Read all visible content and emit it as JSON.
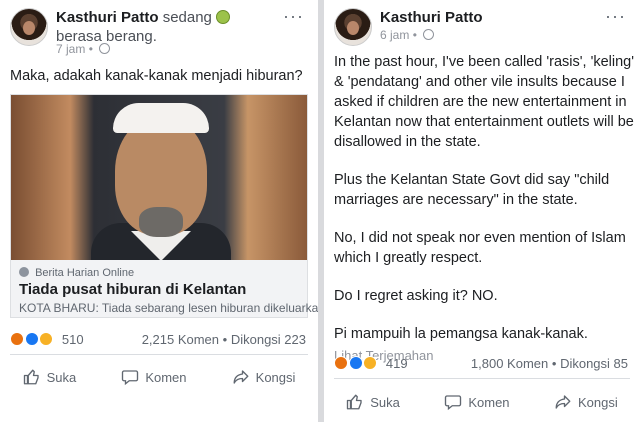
{
  "left": {
    "name": "Kasthuri Patto",
    "feeling_pre": "sedang",
    "feeling_post": "berasa berang.",
    "time": "7 jam",
    "post_text": "Maka, adakah kanak-kanak menjadi hiburan?",
    "link": {
      "source": "Berita Harian Online",
      "headline": "Tiada pusat hiburan di Kelantan",
      "description": "KOTA BHARU: Tiada sebarang lesen hiburan dikeluarkan..."
    },
    "reaction_count": "510",
    "comments": "2,215 Komen",
    "shares": "Dikongsi 223"
  },
  "right": {
    "name": "Kasthuri Patto",
    "time": "6 jam",
    "paragraphs": [
      "In the past hour, I've been called 'rasis', 'keling' & 'pendatang' and other vile insults because I asked if children are the new entertainment in Kelantan now that entertainment outlets will be disallowed in the state.",
      "Plus the Kelantan State Govt did say \"child marriages are necessary\" in the state.",
      "No, I did not speak nor even mention of Islam which I greatly respect.",
      "Do I regret asking it? NO.",
      "Pi mampuih la pemangsa kanak-kanak."
    ],
    "see_translation": "Lihat Terjemahan",
    "reaction_count": "419",
    "comments": "1,800 Komen",
    "shares": "Dikongsi 85"
  },
  "actions": {
    "like": "Suka",
    "comment": "Komen",
    "share": "Kongsi"
  },
  "separator": "•",
  "more": "···"
}
